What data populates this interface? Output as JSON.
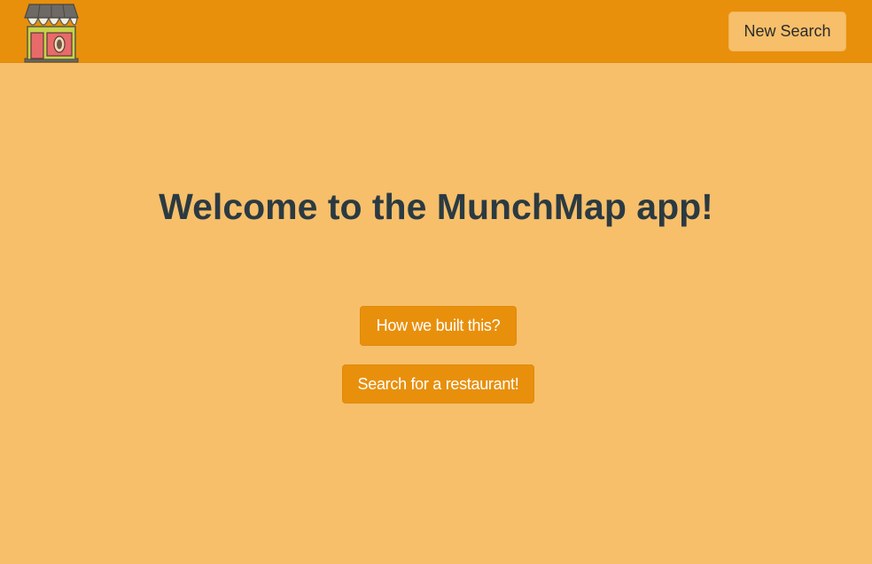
{
  "app": {
    "logo_icon": "storefront-icon"
  },
  "navbar": {
    "new_search_label": "New Search"
  },
  "main": {
    "title": "Welcome to the MunchMap app!",
    "how_built_label": "How we built this?",
    "search_label": "Search for a restaurant!"
  },
  "colors": {
    "navbar_bg": "#e8900c",
    "page_bg": "#f7bf6a",
    "title_color": "#2b3a42",
    "button_bg": "#e8900c"
  }
}
